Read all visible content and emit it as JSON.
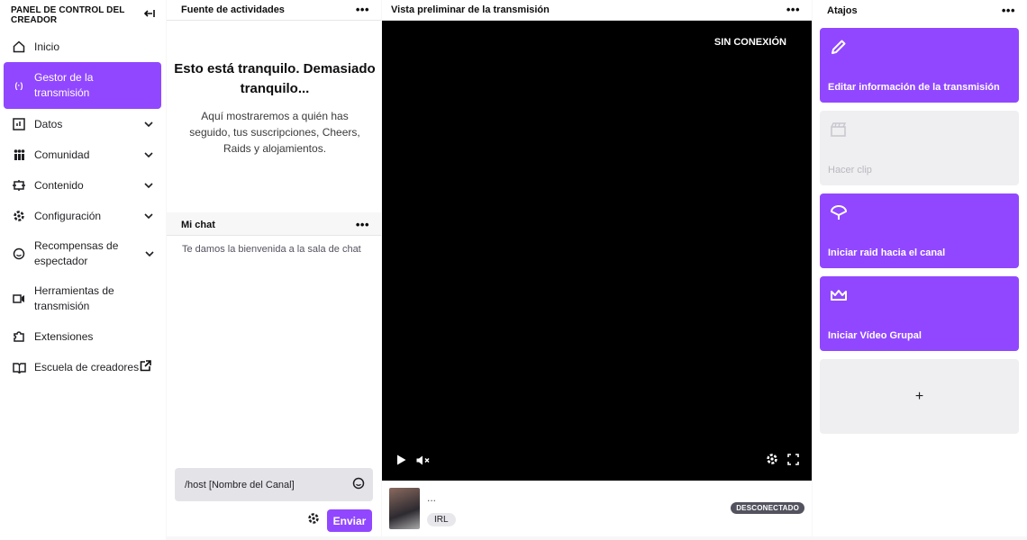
{
  "sidebar": {
    "title": "PANEL DE CONTROL DEL CREADOR",
    "collapse_icon": "collapse-left-icon",
    "items": [
      {
        "label": "Inicio",
        "icon": "home-icon"
      },
      {
        "label": "Gestor de la transmisión",
        "icon": "broadcast-icon",
        "active": true
      },
      {
        "label": "Datos",
        "icon": "data-icon",
        "expandable": true
      },
      {
        "label": "Comunidad",
        "icon": "community-icon",
        "expandable": true
      },
      {
        "label": "Contenido",
        "icon": "content-icon",
        "expandable": true
      },
      {
        "label": "Configuración",
        "icon": "settings-icon",
        "expandable": true
      },
      {
        "label": "Recompensas de espectador",
        "icon": "rewards-icon",
        "expandable": true
      },
      {
        "label": "Herramientas de transmisión",
        "icon": "camera-icon"
      },
      {
        "label": "Extensiones",
        "icon": "puzzle-icon"
      },
      {
        "label": "Escuela de creadores",
        "icon": "book-icon",
        "external": true
      }
    ]
  },
  "activity": {
    "header": "Fuente de actividades",
    "title": "Esto está tranquilo. Demasiado tranquilo...",
    "body": "Aquí mostraremos a quién has seguido, tus suscripciones, Cheers, Raids y alojamientos."
  },
  "chat": {
    "header": "Mi chat",
    "welcome": "Te damos la bienvenida a la sala de chat",
    "input_value": "/host [Nombre del Canal]",
    "send_label": "Enviar"
  },
  "preview": {
    "header": "Vista preliminar de la transmisión",
    "offline_label": "SIN CONEXIÓN",
    "stream_title": "...",
    "tag": "IRL",
    "status_badge": "DESCONECTADO"
  },
  "shortcuts": {
    "header": "Atajos",
    "items": [
      {
        "label": "Editar información de la transmisión",
        "icon": "pencil-icon",
        "enabled": true
      },
      {
        "label": "Hacer clip",
        "icon": "clapper-icon",
        "enabled": false
      },
      {
        "label": "Iniciar raid hacia el canal",
        "icon": "raid-icon",
        "enabled": true
      },
      {
        "label": "Iniciar Vídeo Grupal",
        "icon": "crown-icon",
        "enabled": true
      }
    ],
    "add_label": "+"
  },
  "more_label": "•••",
  "colors": {
    "accent": "#9147ff",
    "video_bg": "#000000",
    "badge_bg": "#53535f"
  }
}
